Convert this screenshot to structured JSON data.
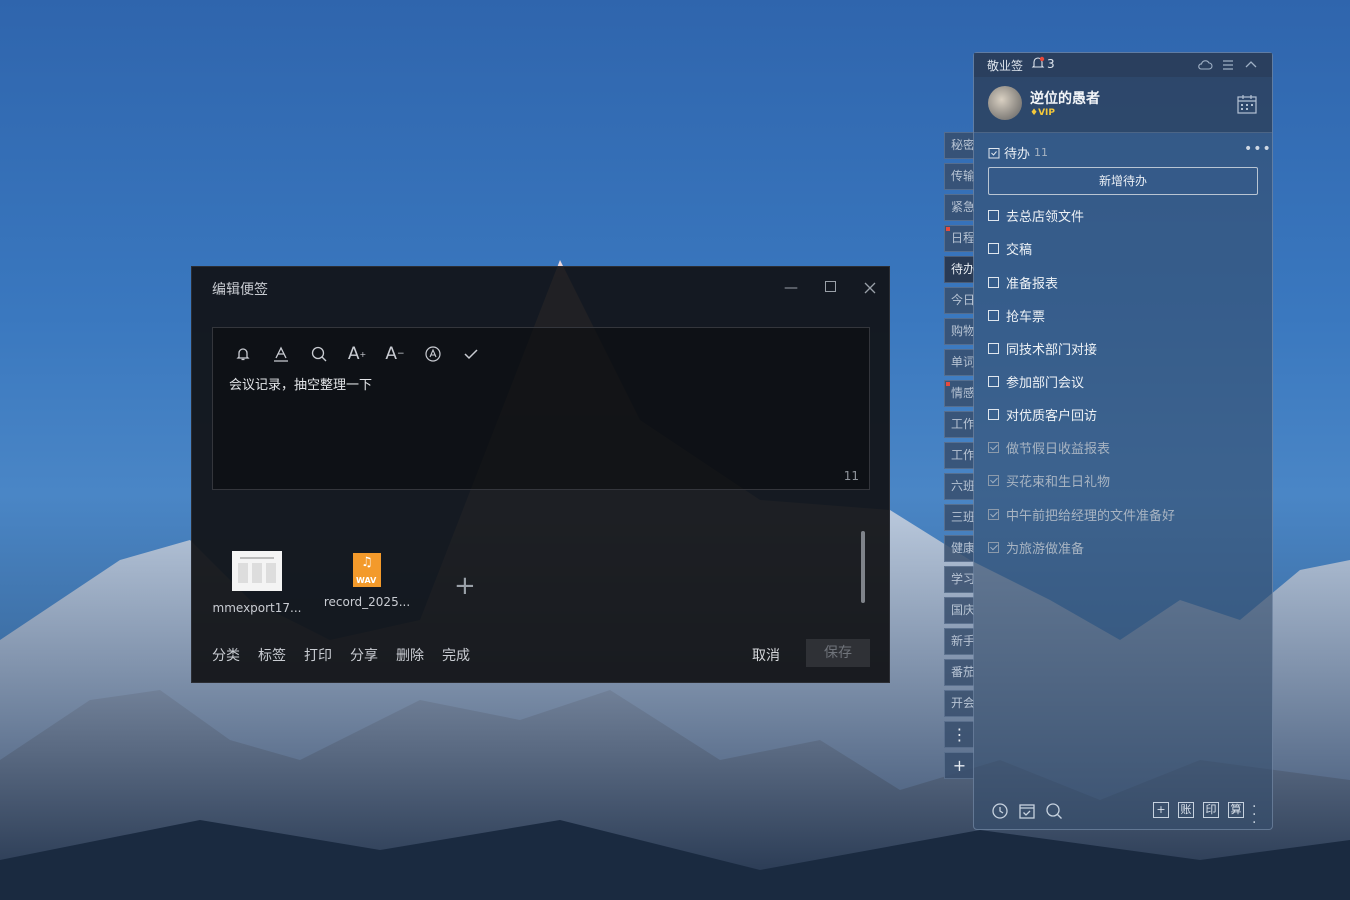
{
  "editor": {
    "title": "编辑便签",
    "note_text": "会议记录，抽空整理一下",
    "char_count": "11",
    "attachments": [
      {
        "name": "mmexport17...",
        "type": "image"
      },
      {
        "name": "record_2025...",
        "type": "wav",
        "badge": "WAV"
      }
    ],
    "bottom_links": [
      "分类",
      "标签",
      "打印",
      "分享",
      "删除",
      "完成"
    ],
    "cancel_label": "取消",
    "save_label": "保存",
    "toolbar_icons": [
      "bell-icon",
      "font-color-icon",
      "search-icon",
      "font-increase-icon",
      "font-decrease-icon",
      "auto-format-icon",
      "check-icon"
    ],
    "font_increase_label": "A",
    "font_decrease_label": "A"
  },
  "side_tabs": [
    "秘密",
    "传输",
    "紧急",
    "日程",
    "待办",
    "今日",
    "购物",
    "单词",
    "情感",
    "工作",
    "工作",
    "六班",
    "三班",
    "健康",
    "学习",
    "国庆",
    "新手",
    "番茄",
    "开会"
  ],
  "panel": {
    "app_name": "敬业签",
    "notification_count": "3",
    "user_name": "逆位的愚者",
    "vip_label": "VIP",
    "section_title": "待办",
    "section_count": "11",
    "add_todo_label": "新增待办",
    "todos": [
      {
        "text": "去总店领文件",
        "done": false
      },
      {
        "text": "交稿",
        "done": false
      },
      {
        "text": "准备报表",
        "done": false
      },
      {
        "text": "抢车票",
        "done": false
      },
      {
        "text": "同技术部门对接",
        "done": false
      },
      {
        "text": "参加部门会议",
        "done": false
      },
      {
        "text": "对优质客户回访",
        "done": false
      },
      {
        "text": "做节假日收益报表",
        "done": true
      },
      {
        "text": "买花束和生日礼物",
        "done": true
      },
      {
        "text": "中午前把给经理的文件准备好",
        "done": true
      },
      {
        "text": "为旅游做准备",
        "done": true
      }
    ],
    "bottom_boxes": [
      "+",
      "账",
      "印",
      "算"
    ]
  },
  "colors": {
    "accent_red": "#e84a3c",
    "vip_gold": "#f3c83a",
    "wav_orange": "#f39a2b"
  }
}
